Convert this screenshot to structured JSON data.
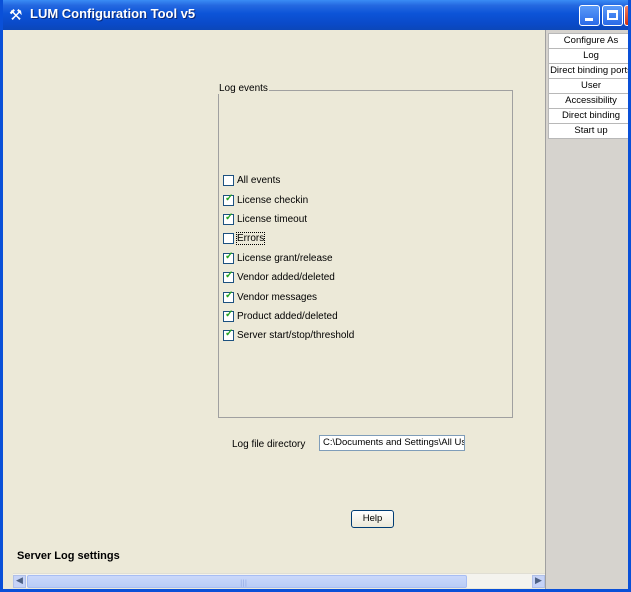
{
  "window": {
    "title": "LUM Configuration Tool v5",
    "app_icon": "wrench-icon"
  },
  "sidebar": {
    "items": [
      {
        "label": "Configure As"
      },
      {
        "label": "Log"
      },
      {
        "label": "Direct binding ports"
      },
      {
        "label": "User"
      },
      {
        "label": "Accessibility"
      },
      {
        "label": "Direct binding"
      },
      {
        "label": "Start up"
      }
    ]
  },
  "log_events": {
    "group_label": "Log events",
    "items": [
      {
        "label": "All events",
        "checked": false
      },
      {
        "label": "License checkin",
        "checked": true
      },
      {
        "label": "License timeout",
        "checked": true
      },
      {
        "label": "Errors",
        "checked": false
      },
      {
        "label": "License grant/release",
        "checked": true
      },
      {
        "label": "Vendor added/deleted",
        "checked": true
      },
      {
        "label": "Vendor messages",
        "checked": true
      },
      {
        "label": "Product added/deleted",
        "checked": true
      },
      {
        "label": "Server start/stop/threshold",
        "checked": true
      }
    ]
  },
  "log_file": {
    "label": "Log file directory",
    "value": "C:\\Documents and Settings\\All Us"
  },
  "buttons": {
    "help": "Help"
  },
  "status": {
    "title": "Server Log settings"
  },
  "colors": {
    "titlebar": "#0a50d8",
    "background": "#ece9d8",
    "checkmark": "#21a121"
  }
}
